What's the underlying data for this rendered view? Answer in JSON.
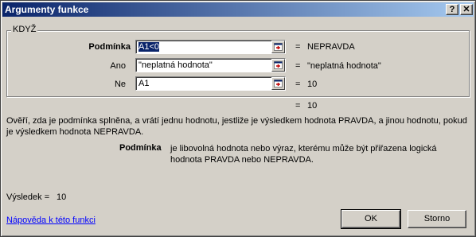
{
  "window": {
    "title": "Argumenty funkce",
    "help_btn": "?",
    "close_btn": "✕"
  },
  "function_group": {
    "name": "KDYŽ",
    "arguments": [
      {
        "label": "Podmínka",
        "value": "A1<0",
        "result": "NEPRAVDA"
      },
      {
        "label": "Ano",
        "value": "\"neplatná hodnota\"",
        "result": "\"neplatná hodnota\""
      },
      {
        "label": "Ne",
        "value": "A1",
        "result": "10"
      }
    ]
  },
  "formula_result": {
    "equals": "=",
    "value": "10"
  },
  "description": "Ověří, zda je podmínka splněna, a vrátí jednu hodnotu, jestliže je výsledkem hodnota PRAVDA, a jinou hodnotu, pokud je výsledkem hodnota NEPRAVDA.",
  "argument_help": {
    "name": "Podmínka",
    "text": "je libovolná hodnota nebo výraz, kterému může být přiřazena logická hodnota PRAVDA nebo NEPRAVDA."
  },
  "result": {
    "label": "Výsledek =",
    "value": "10"
  },
  "help_link": "Nápověda k této funkci",
  "buttons": {
    "ok": "OK",
    "cancel": "Storno"
  }
}
